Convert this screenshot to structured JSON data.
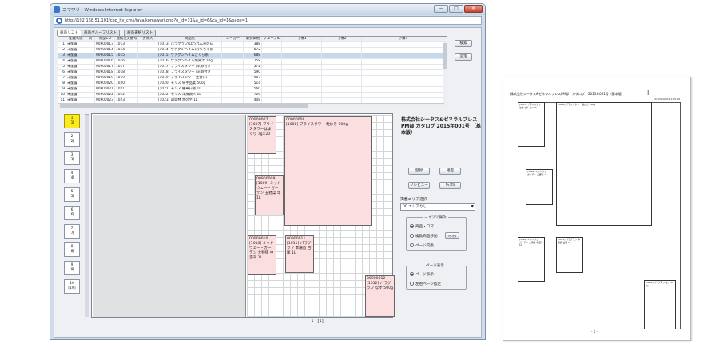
{
  "window": {
    "title": "コマワリ - Windows Internet Explorer",
    "url": "http://192.168.51.101/cgp_hy_cms/java/komawari.php?o_id=31&a_id=6&ca_id=1&page=1",
    "min_glyph": "−",
    "max_glyph": "□",
    "close_glyph": "✕"
  },
  "tabs": [
    "商品リスト",
    "商品グループリスト",
    "商品選択リスト"
  ],
  "table": {
    "headers": [
      "",
      "配置状態",
      "頁",
      "商品CD",
      "連携注文番号",
      "分類大",
      "商品名",
      "メーカー",
      "販売価格",
      "グループID",
      "予備1",
      "予備2",
      "予備3"
    ],
    "rows": [
      [
        "1",
        "未配置",
        "",
        "00900013",
        "1013",
        "",
        "[1013] パラグラフ(ほうれん草の白",
        "",
        "388",
        "",
        "",
        "",
        ""
      ],
      [
        "2",
        "未配置",
        "",
        "00900014",
        "1014",
        "",
        "[1014] ヴァグンハイム(おちちゃ系",
        "",
        "872",
        "",
        "",
        "",
        ""
      ],
      [
        "3",
        "未配置",
        "",
        "00900015",
        "1015",
        "",
        "[1015] ヴァグンハイムさくら系",
        "",
        "688",
        "",
        "",
        "",
        ""
      ],
      [
        "4",
        "未配置",
        "",
        "00900016",
        "1016",
        "",
        "[1016] ヴァグンハイム焼果汁 10g",
        "",
        "158",
        "",
        "",
        "",
        ""
      ],
      [
        "5",
        "未配置",
        "",
        "00900017",
        "1017",
        "",
        "[1017] ブライスタワー 白(卵付き",
        "",
        "372",
        "",
        "",
        "",
        ""
      ],
      [
        "6",
        "未配置",
        "",
        "00900018",
        "1018",
        "",
        "[1018] ブライスタワー 白(卵付き",
        "",
        "590",
        "",
        "",
        "",
        ""
      ],
      [
        "7",
        "未配置",
        "",
        "00900019",
        "1019",
        "",
        "[1019] ブライスタワー 生食(ス",
        "",
        "907",
        "",
        "",
        "",
        ""
      ],
      [
        "8",
        "未配置",
        "",
        "00900020",
        "1020",
        "",
        "[1020] モリス 卓手品集 500g",
        "",
        "514",
        "",
        "",
        "",
        ""
      ],
      [
        "9",
        "未配置",
        "",
        "00900021",
        "1021",
        "",
        "[1021] モリス 種華白飯 1L",
        "",
        "560",
        "",
        "",
        "",
        ""
      ],
      [
        "10",
        "未配置",
        "",
        "00900022",
        "1022",
        "",
        "[1022] モリス 洋風鍋入 1L",
        "",
        "726",
        "",
        "",
        "",
        ""
      ],
      [
        "11",
        "未配置",
        "",
        "00900023",
        "1023",
        "",
        "[1023] 山盛林 黒の芋 1L",
        "",
        "408",
        "",
        "",
        "",
        ""
      ]
    ],
    "selected_index": 2
  },
  "side_buttons": {
    "search": "検索",
    "settings": "設定"
  },
  "pages": [
    {
      "num": "1",
      "sub": "[1]"
    },
    {
      "num": "2",
      "sub": "[2]"
    },
    {
      "num": "3",
      "sub": "[3]"
    },
    {
      "num": "4",
      "sub": "[4]"
    },
    {
      "num": "5",
      "sub": "[5]"
    },
    {
      "num": "6",
      "sub": "[6]"
    },
    {
      "num": "7",
      "sub": "[7]"
    },
    {
      "num": "8",
      "sub": "[8]"
    },
    {
      "num": "9",
      "sub": "[9]"
    },
    {
      "num": "10",
      "sub": "[10]"
    }
  ],
  "layout_items": [
    {
      "code": "00900007",
      "text": "[1007] ブライスタワーはまぐり 7g×20"
    },
    {
      "code": "00900008",
      "text": "[1008] ブライスタワー 粒炒き 100g"
    },
    {
      "code": "00900009",
      "text": "[1009] ミッドウェー・ガーデン 五野菜 年 1L"
    },
    {
      "code": "00900010",
      "text": "[1010] ミッドウェー・ガーデン 大特抜 中濃辛 1L"
    },
    {
      "code": "00900011",
      "text": "[1011] パラグラフ 本醸造 古尾 1L"
    },
    {
      "code": "00900012",
      "text": "[1012] パラグラフ なす 500g"
    }
  ],
  "page_footer": "- 1 - [1]",
  "catalog_title": "株式会社シータス&ゼネラルプレスPM部 カタログ 2015年001号 （基本版）",
  "action_buttons": {
    "register": "登録",
    "confirm": "確定",
    "preview": "プレビュー",
    "cancel": "ｷｬﾝｾﾙ"
  },
  "area_label": "掲載エリア選択",
  "area_select": "00 エリアなし",
  "komawari_group": {
    "title": "コマワリ操作",
    "options": [
      "商品・コマ",
      "複数商品移動",
      "ページ交換"
    ],
    "selected": 0,
    "cancel_small": "ｷｬﾝｾﾙ"
  },
  "page_display_group": {
    "title": "ページ表示",
    "options": [
      "ページ表示",
      "左右ページ指定"
    ],
    "selected": 0
  },
  "print": {
    "title": "株式会社シータス&ゼネラルプレスPM部　カタログ　2015年001号（基本版）",
    "date": "2015/09/30 11:05:18",
    "cursor": "I",
    "items": [
      {
        "text": "[1007] ブライスタワーはまぐり 7g×20"
      },
      {
        "text": "[1008] ブライスタワー 粒炒き 100g"
      },
      {
        "text": "[1009] ミッドウェー・ガーデン 五野菜 1L"
      },
      {
        "text": "[1010] ミッドウェー・ガーデン 大特抜 中濃辛 1L"
      },
      {
        "text": "[1011] パラグラフ 本醸造 古尾 1L"
      },
      {
        "text": "[1012] パラグラフ なす 500g"
      }
    ],
    "footer": "- 1 -"
  }
}
